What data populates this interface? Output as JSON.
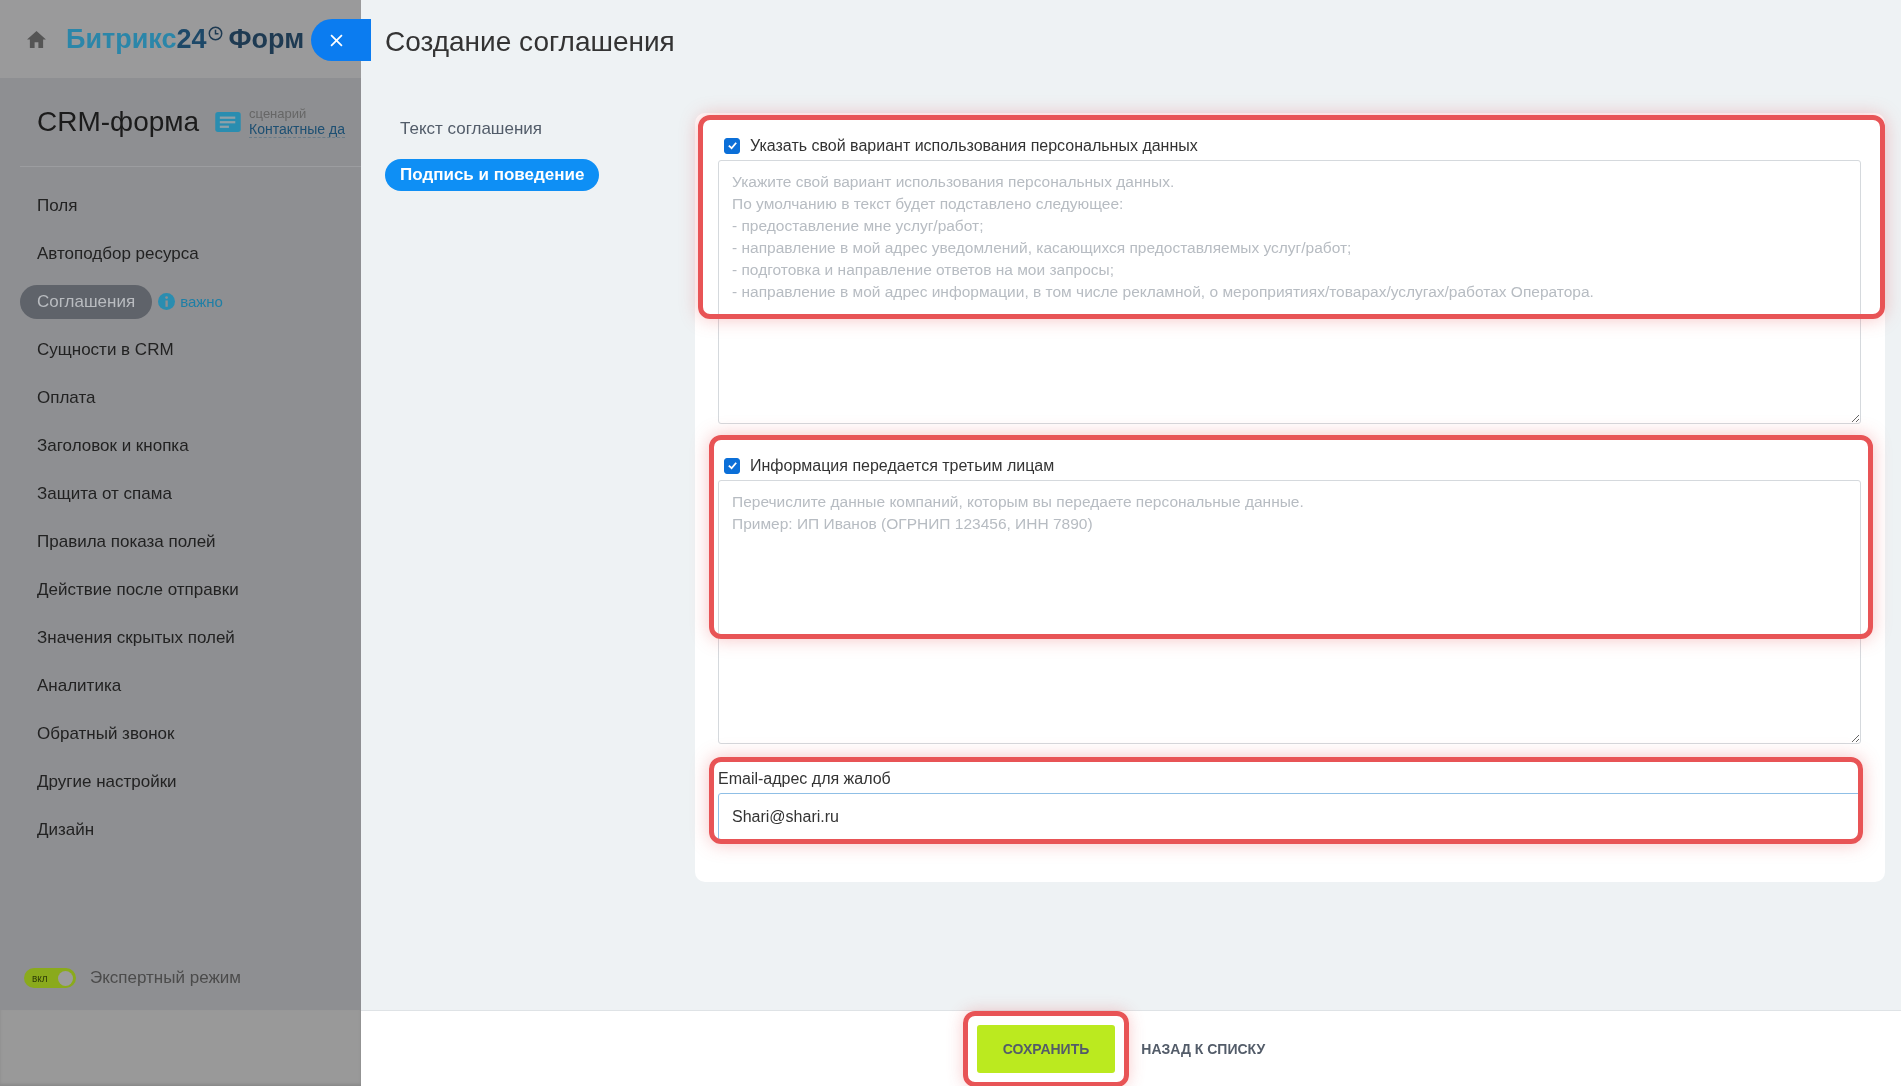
{
  "header": {
    "brand": "Битрикс",
    "brand_number": "24",
    "product": "Форм"
  },
  "sidebar": {
    "title": "CRM-форма",
    "scenario_label": "сценарий",
    "scenario_link": "Контактные да",
    "items": [
      {
        "label": "Поля",
        "selected": false
      },
      {
        "label": "Автоподбор ресурса",
        "selected": false
      },
      {
        "label": "Соглашения",
        "selected": true,
        "badge": "важно"
      },
      {
        "label": "Сущности в CRM",
        "selected": false
      },
      {
        "label": "Оплата",
        "selected": false
      },
      {
        "label": "Заголовок и кнопка",
        "selected": false
      },
      {
        "label": "Защита от спама",
        "selected": false
      },
      {
        "label": "Правила показа полей",
        "selected": false
      },
      {
        "label": "Действие после отправки",
        "selected": false
      },
      {
        "label": "Значения скрытых полей",
        "selected": false
      },
      {
        "label": "Аналитика",
        "selected": false
      },
      {
        "label": "Обратный звонок",
        "selected": false
      },
      {
        "label": "Другие настройки",
        "selected": false
      },
      {
        "label": "Дизайн",
        "selected": false
      }
    ],
    "expert_mode": {
      "label": "Экспертный режим",
      "toggle_text": "вкл",
      "on": true
    }
  },
  "panel": {
    "title": "Создание соглашения",
    "tabs": [
      {
        "label": "Текст соглашения",
        "selected": false
      },
      {
        "label": "Подпись и поведение",
        "selected": true
      }
    ],
    "sections": [
      {
        "kind": "checkbox_textarea",
        "label": "Указать свой вариант использования персональных данных",
        "checked": true,
        "highlighted": true,
        "placeholder": "Укажите свой вариант использования персональных данных.\nПо умолчанию в текст будет подставлено следующее:\n- предоставление мне услуг/работ;\n- направление в мой адрес уведомлений, касающихся предоставляемых услуг/работ;\n- подготовка и направление ответов на мои запросы;\n- направление в мой адрес информации, в том числе рекламной, о мероприятиях/товарах/услугах/работах Оператора."
      },
      {
        "kind": "checkbox_textarea",
        "label": "Информация передается третьим лицам",
        "checked": true,
        "highlighted": true,
        "placeholder": "Перечислите данные компаний, которым вы передаете персональные данные.\nПример: ИП Иванов (ОГРНИП 123456, ИНН 7890)"
      },
      {
        "kind": "input",
        "label": "Email-адрес для жалоб",
        "value": "Shari@shari.ru",
        "highlighted": true
      }
    ]
  },
  "footer": {
    "save": {
      "label": "СОХРАНИТЬ",
      "highlighted": true
    },
    "back": "НАЗАД К СПИСКУ"
  }
}
